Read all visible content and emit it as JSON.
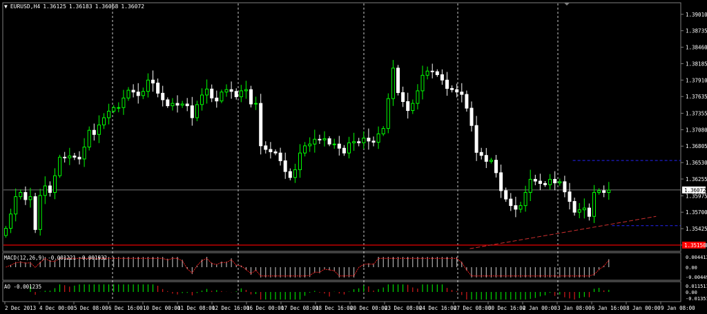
{
  "header": {
    "menu_arrow": "▼",
    "symbol": "EURUSD,H4",
    "open": "1.36125",
    "high": "1.36183",
    "low": "1.36068",
    "close": "1.36072"
  },
  "macd": {
    "label": "MACD(12,26,9)",
    "main": "-0.001221",
    "signal": "-0.001932",
    "scale": [
      "0.004413",
      "0.00",
      "-0.004495"
    ]
  },
  "ao": {
    "label": "AO",
    "value": "-0.001235",
    "scale": [
      "0.011511",
      "0.00",
      "-0.01351"
    ]
  },
  "colors": {
    "background": "#000000",
    "bull": "#00ff00",
    "bear": "#ffffff",
    "grid": "#ffffff",
    "trendline_red": "#d03030",
    "channel_blue": "#2020e0",
    "price_box": "#ffffff",
    "support_box": "#ff0000"
  },
  "chart_data": {
    "type": "candlestick",
    "symbol": "EURUSD",
    "timeframe": "H4",
    "current_price": "1.36072",
    "support_price": "1.35150",
    "ylim": [
      1.3508,
      1.3918
    ],
    "y_ticks": [
      "1.39010",
      "1.38735",
      "1.38460",
      "1.38185",
      "1.37910",
      "1.37635",
      "1.37355",
      "1.37080",
      "1.36805",
      "1.36530",
      "1.36255",
      "1.35975",
      "1.35700",
      "1.35425",
      "1.35150"
    ],
    "x_ticks": [
      "2 Dec 2013",
      "4 Dec 00:00",
      "5 Dec 08:00",
      "6 Dec 16:00",
      "10 Dec 00:00",
      "11 Dec 08:00",
      "12 Dec 16:00",
      "16 Dec 00:00",
      "17 Dec 08:00",
      "18 Dec 16:00",
      "20 Dec 00:00",
      "23 Dec 08:00",
      "24 Dec 16:00",
      "27 Dec 08:00",
      "30 Dec 16:00",
      "2 Jan 00:00",
      "3 Jan 08:00",
      "6 Jan 16:00",
      "8 Jan 00:00",
      "9 Jan 08:00"
    ],
    "close_path": [
      1.3543,
      1.3567,
      1.3596,
      1.3603,
      1.3591,
      1.3596,
      1.3541,
      1.3598,
      1.3614,
      1.3603,
      1.3631,
      1.3662,
      1.3661,
      1.3664,
      1.3662,
      1.3659,
      1.3679,
      1.3707,
      1.37,
      1.3716,
      1.3728,
      1.3739,
      1.3745,
      1.3745,
      1.3761,
      1.3774,
      1.3771,
      1.3765,
      1.3772,
      1.3791,
      1.3786,
      1.3769,
      1.3758,
      1.3748,
      1.3752,
      1.3749,
      1.3751,
      1.3748,
      1.3728,
      1.375,
      1.3766,
      1.3776,
      1.3761,
      1.3756,
      1.3771,
      1.3775,
      1.3772,
      1.3763,
      1.3773,
      1.3775,
      1.3751,
      1.3752,
      1.3681,
      1.3675,
      1.3671,
      1.3669,
      1.3656,
      1.3638,
      1.3628,
      1.3641,
      1.3669,
      1.3681,
      1.3684,
      1.3692,
      1.3691,
      1.3693,
      1.3684,
      1.3684,
      1.3677,
      1.3669,
      1.3686,
      1.3688,
      1.3686,
      1.3694,
      1.3689,
      1.3687,
      1.3701,
      1.371,
      1.376,
      1.3811,
      1.377,
      1.3755,
      1.374,
      1.3752,
      1.3773,
      1.3799,
      1.3806,
      1.3805,
      1.38,
      1.3791,
      1.3777,
      1.3775,
      1.3771,
      1.3767,
      1.3744,
      1.3715,
      1.367,
      1.3665,
      1.3655,
      1.3657,
      1.3636,
      1.3606,
      1.3592,
      1.3581,
      1.3575,
      1.3581,
      1.3603,
      1.3625,
      1.3622,
      1.3618,
      1.3616,
      1.3625,
      1.3619,
      1.3621,
      1.3604,
      1.3588,
      1.357,
      1.3574,
      1.3577,
      1.3563,
      1.3603,
      1.3606,
      1.3603,
      1.3607
    ],
    "channel_top": 1.36565,
    "channel_bottom": 1.35475,
    "trendline": {
      "from": [
        95,
        1.3509
      ],
      "to": [
        133,
        1.3563
      ]
    }
  }
}
